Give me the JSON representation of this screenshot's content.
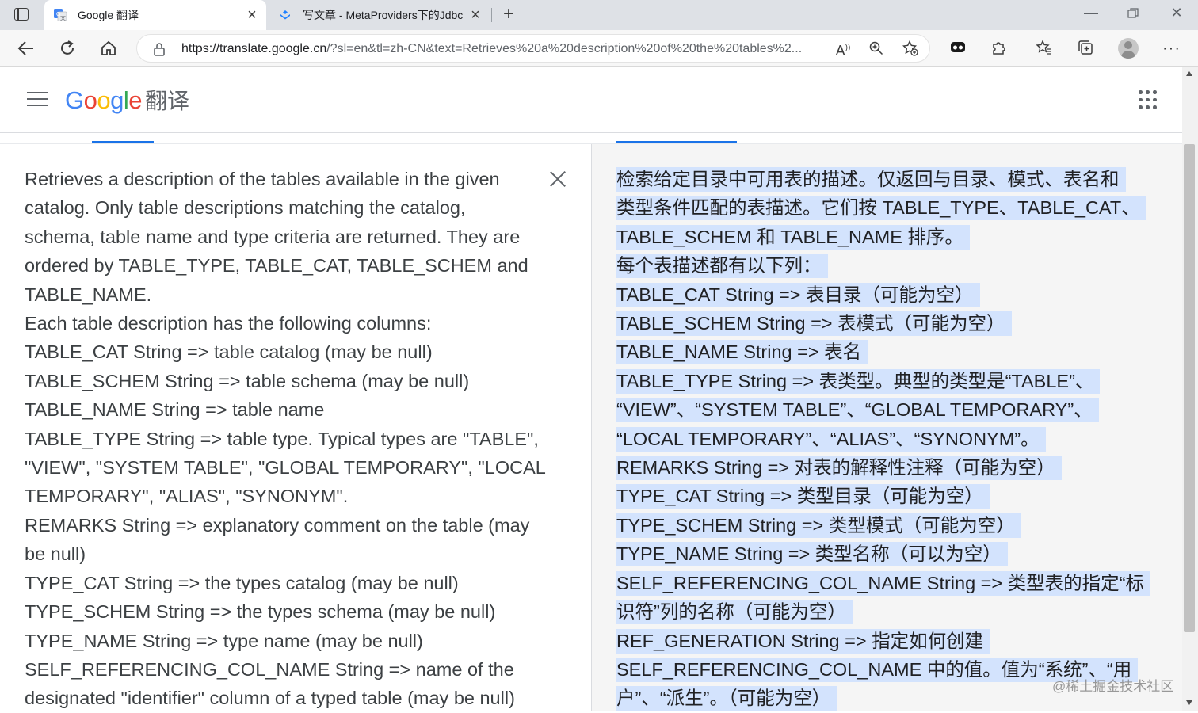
{
  "browser": {
    "tabs": [
      {
        "title": "Google 翻译",
        "active": true,
        "icon": "google-translate-favicon"
      },
      {
        "title": "写文章 - MetaProviders下的Jdbc",
        "active": false,
        "icon": "juejin-favicon"
      }
    ],
    "url_host": "https://translate.google.cn",
    "url_path": "/?sl=en&tl=zh-CN&text=Retrieves%20a%20description%20of%20the%20tables%2..."
  },
  "header": {
    "logo_letters": [
      "G",
      "o",
      "o",
      "g",
      "l",
      "e"
    ],
    "product": "翻译"
  },
  "source": {
    "lines": [
      "Retrieves a description of the tables available in the given",
      "catalog. Only table descriptions matching the catalog,",
      "schema, table name and type criteria are returned. They are",
      "ordered by TABLE_TYPE, TABLE_CAT, TABLE_SCHEM and",
      "TABLE_NAME.",
      "Each table description has the following columns:",
      "TABLE_CAT String => table catalog (may be null)",
      "TABLE_SCHEM String => table schema (may be null)",
      "TABLE_NAME String => table name",
      "TABLE_TYPE String => table type. Typical types are \"TABLE\",",
      "\"VIEW\", \"SYSTEM TABLE\", \"GLOBAL TEMPORARY\", \"LOCAL",
      "TEMPORARY\", \"ALIAS\", \"SYNONYM\".",
      "REMARKS String => explanatory comment on the table (may",
      "be null)",
      "TYPE_CAT String => the types catalog (may be null)",
      "TYPE_SCHEM String => the types schema (may be null)",
      "TYPE_NAME String => type name (may be null)",
      "SELF_REFERENCING_COL_NAME String => name of the",
      "designated \"identifier\" column of a typed table (may be null)"
    ]
  },
  "target": {
    "lines": [
      "检索给定目录中可用表的描述。仅返回与目录、模式、表名和",
      "类型条件匹配的表描述。它们按 TABLE_TYPE、TABLE_CAT、",
      "TABLE_SCHEM 和 TABLE_NAME 排序。",
      "每个表描述都有以下列：",
      "TABLE_CAT String => 表目录（可能为空）",
      "TABLE_SCHEM String => 表模式（可能为空）",
      "TABLE_NAME String => 表名",
      "TABLE_TYPE String => 表类型。典型的类型是“TABLE”、",
      "“VIEW”、“SYSTEM TABLE”、“GLOBAL TEMPORARY”、",
      "“LOCAL TEMPORARY”、“ALIAS”、“SYNONYM”。",
      "REMARKS String => 对表的解释性注释（可能为空）",
      "TYPE_CAT String => 类型目录（可能为空）",
      "TYPE_SCHEM String => 类型模式（可能为空）",
      "TYPE_NAME String => 类型名称（可以为空）",
      "SELF_REFERENCING_COL_NAME String => 类型表的指定“标",
      "识符”列的名称（可能为空）",
      "REF_GENERATION String => 指定如何创建",
      "SELF_REFERENCING_COL_NAME 中的值。值为“系统”、“用",
      "户”、“派生”。（可能为空）"
    ]
  },
  "watermark": "@稀土掘金技术社区",
  "colors": {
    "accent": "#1a73e8",
    "highlight": "#d3e3fd"
  }
}
